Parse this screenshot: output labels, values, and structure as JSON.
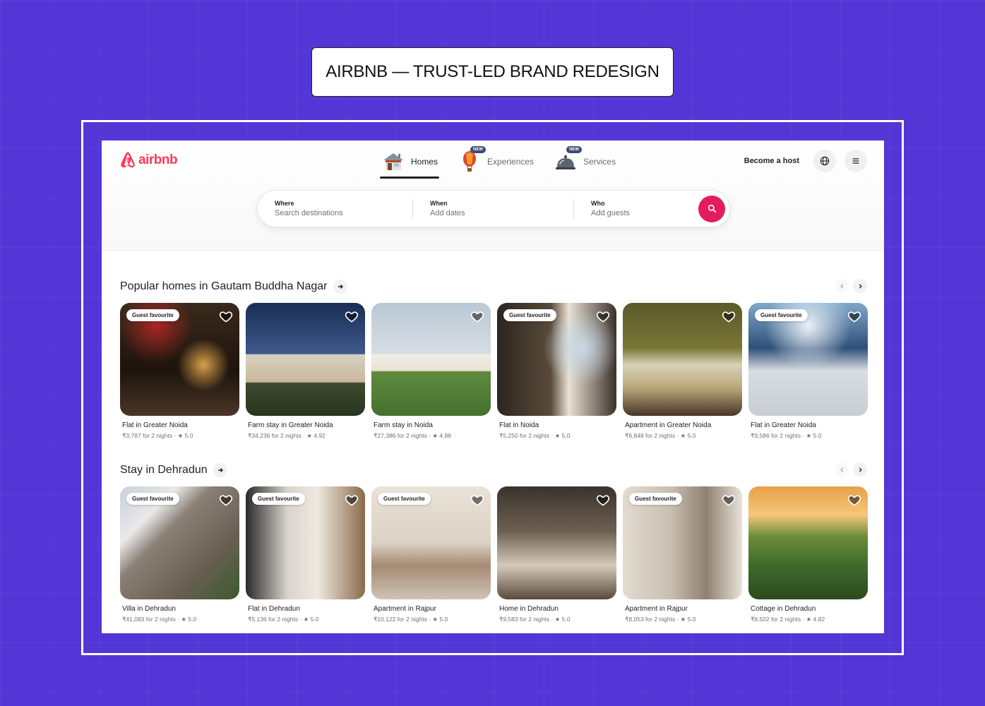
{
  "page_title": "AIRBNB — TRUST-LED BRAND REDESIGN",
  "brand": {
    "name": "airbnb",
    "color": "#ff385c"
  },
  "nav": {
    "tabs": [
      {
        "label": "Homes",
        "icon": "house-icon",
        "active": true
      },
      {
        "label": "Experiences",
        "icon": "hot-air-balloon-icon",
        "badge": "NEW"
      },
      {
        "label": "Services",
        "icon": "service-bell-icon",
        "badge": "NEW"
      }
    ],
    "host_link": "Become a host"
  },
  "search": {
    "where_label": "Where",
    "where_placeholder": "Search destinations",
    "when_label": "When",
    "when_placeholder": "Add dates",
    "who_label": "Who",
    "who_placeholder": "Add guests",
    "button_color": "#e31c5f"
  },
  "sections": [
    {
      "title": "Popular homes in Gautam Buddha Nagar",
      "listings": [
        {
          "badge": "Guest favourite",
          "title": "Flat in Greater Noida",
          "meta": "₹3,787 for 2 nights · ★ 5.0"
        },
        {
          "badge": "",
          "title": "Farm stay in Greater Noida",
          "meta": "₹34,236 for 2 nights · ★ 4.92"
        },
        {
          "badge": "",
          "title": "Farm stay in Noida",
          "meta": "₹27,386 for 2 nights · ★ 4.88"
        },
        {
          "badge": "Guest favourite",
          "title": "Flat in Noida",
          "meta": "₹5,250 for 2 nights · ★ 5.0"
        },
        {
          "badge": "",
          "title": "Apartment in Greater Noida",
          "meta": "₹6,848 for 2 nights · ★ 5.0"
        },
        {
          "badge": "Guest favourite",
          "title": "Flat in Greater Noida",
          "meta": "₹9,586 for 2 nights · ★ 5.0"
        }
      ]
    },
    {
      "title": "Stay in Dehradun",
      "listings": [
        {
          "badge": "Guest favourite",
          "title": "Villa in Dehradun",
          "meta": "₹41,083 for 2 nights · ★ 5.0"
        },
        {
          "badge": "Guest favourite",
          "title": "Flat in Dehradun",
          "meta": "₹5,136 for 2 nights · ★ 5.0"
        },
        {
          "badge": "Guest favourite",
          "title": "Apartment in Rajpur",
          "meta": "₹10,122 for 2 nights · ★ 5.0"
        },
        {
          "badge": "",
          "title": "Home in Dehradun",
          "meta": "₹9,583 for 2 nights · ★ 5.0"
        },
        {
          "badge": "Guest favourite",
          "title": "Apartment in Rajpur",
          "meta": "₹8,053 for 2 nights · ★ 5.0"
        },
        {
          "badge": "",
          "title": "Cottage in Dehradun",
          "meta": "₹8,502 for 2 nights · ★ 4.82"
        }
      ]
    }
  ]
}
